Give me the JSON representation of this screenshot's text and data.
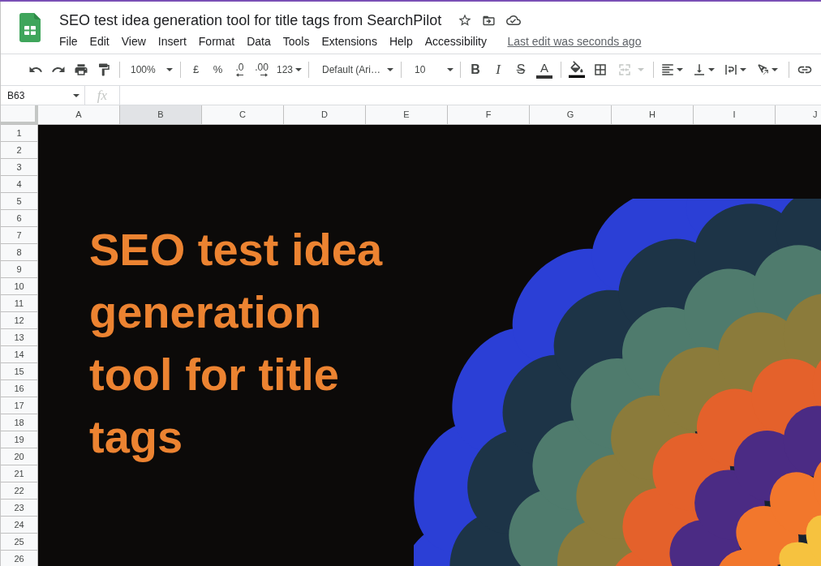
{
  "document": {
    "title": "SEO test idea generation tool for title tags from SearchPilot",
    "last_edit": "Last edit was seconds ago"
  },
  "menu": [
    "File",
    "Edit",
    "View",
    "Insert",
    "Format",
    "Data",
    "Tools",
    "Extensions",
    "Help",
    "Accessibility"
  ],
  "toolbar": {
    "zoom": "100%",
    "currency": "£",
    "percent": "%",
    "decimals_decrease": ".0",
    "decimals_increase": ".00",
    "number_format": "123",
    "font": "Default (Ari…",
    "font_size": "10",
    "bold": "B",
    "italic": "I",
    "strikethrough": "S",
    "text_color": "A",
    "merge": {
      "disabled": true
    }
  },
  "formula_bar": {
    "name_box": "B63",
    "function_label": "fx"
  },
  "sheet": {
    "columns": [
      {
        "label": "A",
        "selected": false
      },
      {
        "label": "B",
        "selected": true
      },
      {
        "label": "C",
        "selected": false
      },
      {
        "label": "D",
        "selected": false
      },
      {
        "label": "E",
        "selected": false
      },
      {
        "label": "F",
        "selected": false
      },
      {
        "label": "G",
        "selected": false
      },
      {
        "label": "H",
        "selected": false
      },
      {
        "label": "I",
        "selected": false
      },
      {
        "label": "J",
        "selected": false
      }
    ],
    "rows": [
      {
        "label": "1",
        "selected": false
      },
      {
        "label": "2",
        "selected": false
      },
      {
        "label": "3",
        "selected": false
      },
      {
        "label": "4",
        "selected": false
      },
      {
        "label": "5",
        "selected": false
      },
      {
        "label": "6",
        "selected": false
      },
      {
        "label": "7",
        "selected": false
      },
      {
        "label": "8",
        "selected": false
      },
      {
        "label": "9",
        "selected": false
      },
      {
        "label": "10",
        "selected": false
      },
      {
        "label": "11",
        "selected": false
      },
      {
        "label": "12",
        "selected": false
      },
      {
        "label": "13",
        "selected": false
      },
      {
        "label": "14",
        "selected": false
      },
      {
        "label": "15",
        "selected": false
      },
      {
        "label": "16",
        "selected": false
      },
      {
        "label": "17",
        "selected": false
      },
      {
        "label": "18",
        "selected": false
      },
      {
        "label": "19",
        "selected": false
      },
      {
        "label": "20",
        "selected": false
      },
      {
        "label": "21",
        "selected": false
      },
      {
        "label": "22",
        "selected": false
      },
      {
        "label": "23",
        "selected": false
      },
      {
        "label": "24",
        "selected": false
      },
      {
        "label": "25",
        "selected": false
      },
      {
        "label": "26",
        "selected": false
      }
    ],
    "image": {
      "title": "SEO test idea generation tool for title tags"
    }
  }
}
